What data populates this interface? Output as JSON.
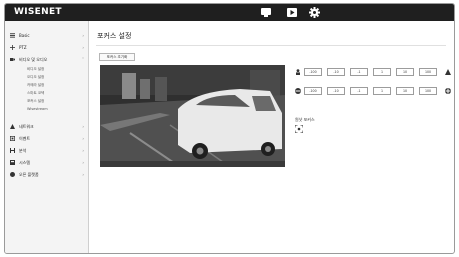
{
  "app": {
    "logo": "WISENET"
  },
  "topbar": {
    "icons": [
      "monitor-icon",
      "playback-icon",
      "settings-gear-icon"
    ]
  },
  "sidebar": {
    "items": [
      {
        "label": "Basic",
        "icon": "list-icon"
      },
      {
        "label": "PTZ",
        "icon": "move-arrows-icon"
      },
      {
        "label": "비디오 및 오디오",
        "icon": "video-audio-icon"
      },
      {
        "label": "네트워크",
        "icon": "network-icon"
      },
      {
        "label": "이벤트",
        "icon": "event-icon"
      },
      {
        "label": "분석",
        "icon": "analytics-icon"
      },
      {
        "label": "시스템",
        "icon": "system-icon"
      },
      {
        "label": "오픈 플랫폼",
        "icon": "open-platform-icon"
      }
    ],
    "subitems": [
      "비디오 설정",
      "오디오 설정",
      "카메라 설정",
      "스마트 코덱",
      "포커스 설정",
      "Wisestream"
    ]
  },
  "main": {
    "title": "포커스 설정",
    "reset_label": "포커스 초기화",
    "zoom_steps": [
      "-100",
      "-10",
      "-1",
      "1",
      "10",
      "100"
    ],
    "focus_steps": [
      "-100",
      "-10",
      "-1",
      "1",
      "10",
      "100"
    ],
    "autofocus_label": "원샷 포커스"
  },
  "colors": {
    "topbar": "#1f1f1f",
    "sidebar": "#f4f4f4",
    "border": "#9c9c9c"
  }
}
